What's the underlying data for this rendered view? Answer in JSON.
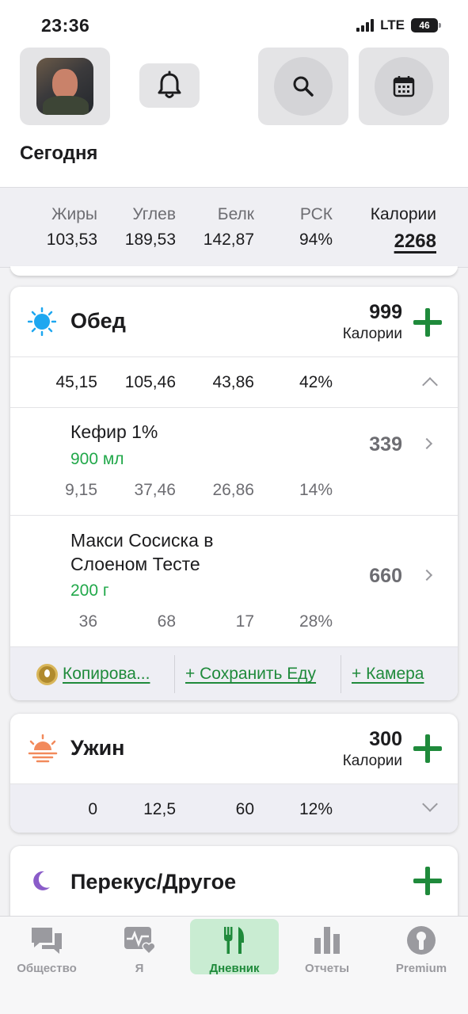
{
  "status_bar": {
    "time": "23:36",
    "network": "LTE",
    "battery": "46"
  },
  "header": {
    "title": "Сегодня",
    "avatar": "user-avatar",
    "icons": [
      "bell-icon",
      "search-icon",
      "calendar-icon"
    ]
  },
  "summary": {
    "columns": [
      {
        "label": "Жиры",
        "value": "103,53"
      },
      {
        "label": "Углев",
        "value": "189,53"
      },
      {
        "label": "Белк",
        "value": "142,87"
      },
      {
        "label": "РСК",
        "value": "94%"
      },
      {
        "label": "Калории",
        "value": "2268"
      }
    ]
  },
  "meals": {
    "lunch": {
      "name": "Обед",
      "calories": "999",
      "calories_label": "Калории",
      "macros": [
        "45,15",
        "105,46",
        "43,86",
        "42%"
      ],
      "items": [
        {
          "name_line1": "Кефир 1%",
          "name_line2": "",
          "qty": "900 мл",
          "calories": "339",
          "macros": [
            "9,15",
            "37,46",
            "26,86",
            "14%"
          ]
        },
        {
          "name_line1": "Макси Сосиска в",
          "name_line2": "Слоеном Тесте",
          "qty": "200 г",
          "calories": "660",
          "macros": [
            "36",
            "68",
            "17",
            "28%"
          ]
        }
      ],
      "actions": {
        "copy": "Копирова...",
        "save": "+ Сохранить Еду",
        "camera": "+ Камера"
      }
    },
    "dinner": {
      "name": "Ужин",
      "calories": "300",
      "calories_label": "Калории",
      "macros": [
        "0",
        "12,5",
        "60",
        "12%"
      ]
    },
    "snack": {
      "name": "Перекус/Другое"
    }
  },
  "tabbar": {
    "tabs": [
      {
        "label": "Общество",
        "icon": "community-icon"
      },
      {
        "label": "Я",
        "icon": "health-icon"
      },
      {
        "label": "Дневник",
        "icon": "diary-icon"
      },
      {
        "label": "Отчеты",
        "icon": "reports-icon"
      },
      {
        "label": "Premium",
        "icon": "premium-icon"
      }
    ],
    "active": "Дневник"
  },
  "colors": {
    "accent": "#1f8a3b",
    "qty_green": "#21a84a",
    "active_tab_bg": "#c9ecd2"
  }
}
